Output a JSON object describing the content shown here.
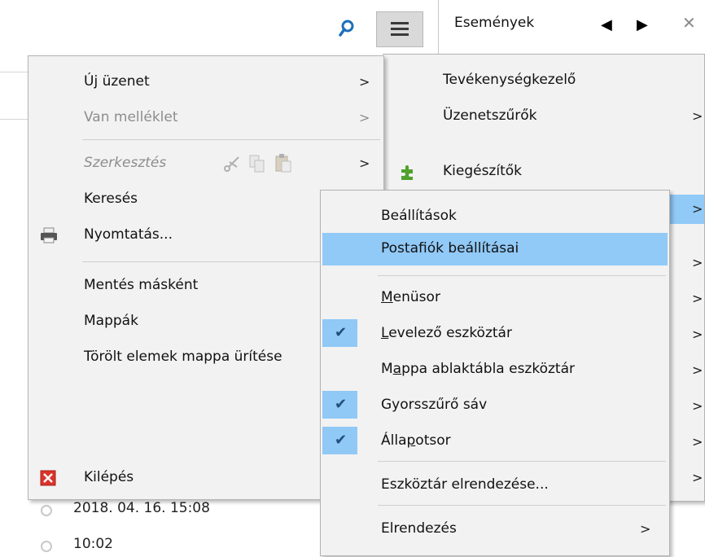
{
  "toolbar": {
    "menu_button": "menu-button"
  },
  "events_panel": {
    "title": "Események",
    "prev": "◀",
    "next": "▶",
    "close": "✕"
  },
  "background_rows": [
    {
      "date": "2018. 04. 16. 15:08"
    },
    {
      "date": "10:02"
    }
  ],
  "main_menu": {
    "new_message": "Új üzenet",
    "has_attachment": "Van melléklet",
    "edit": "Szerkesztés",
    "search": "Keresés",
    "print": "Nyomtatás...",
    "save_as": "Mentés másként",
    "folders": "Mappák",
    "empty_trash": "Törölt elemek mappa ürítése",
    "quit": "Kilépés",
    "chevron": ">"
  },
  "right_menu": {
    "activity_manager": "Tevékenységkezelő",
    "message_filters": "Üzenetszűrők",
    "addons": "Kiegészítők",
    "chevron": ">"
  },
  "options_submenu": {
    "settings": "Beállítások",
    "account_settings": "Postafiók beállításai",
    "menubar_pre": "",
    "menubar_u": "M",
    "menubar_post": "enüsor",
    "mail_toolbar_pre": "",
    "mail_toolbar_u": "L",
    "mail_toolbar_post": "evelező eszköztár",
    "folder_pane_pre": "M",
    "folder_pane_u": "a",
    "folder_pane_post": "ppa ablaktábla eszköztár",
    "quick_filter": "Gyorsszűrő sáv",
    "statusbar_pre": "Álla",
    "statusbar_u": "p",
    "statusbar_post": "otsor",
    "customize": "Eszköztár elrendezése...",
    "layout": "Elrendezés",
    "chevron": ">",
    "checks": {
      "mail_toolbar": true,
      "quick_filter": true,
      "statusbar": true
    }
  }
}
